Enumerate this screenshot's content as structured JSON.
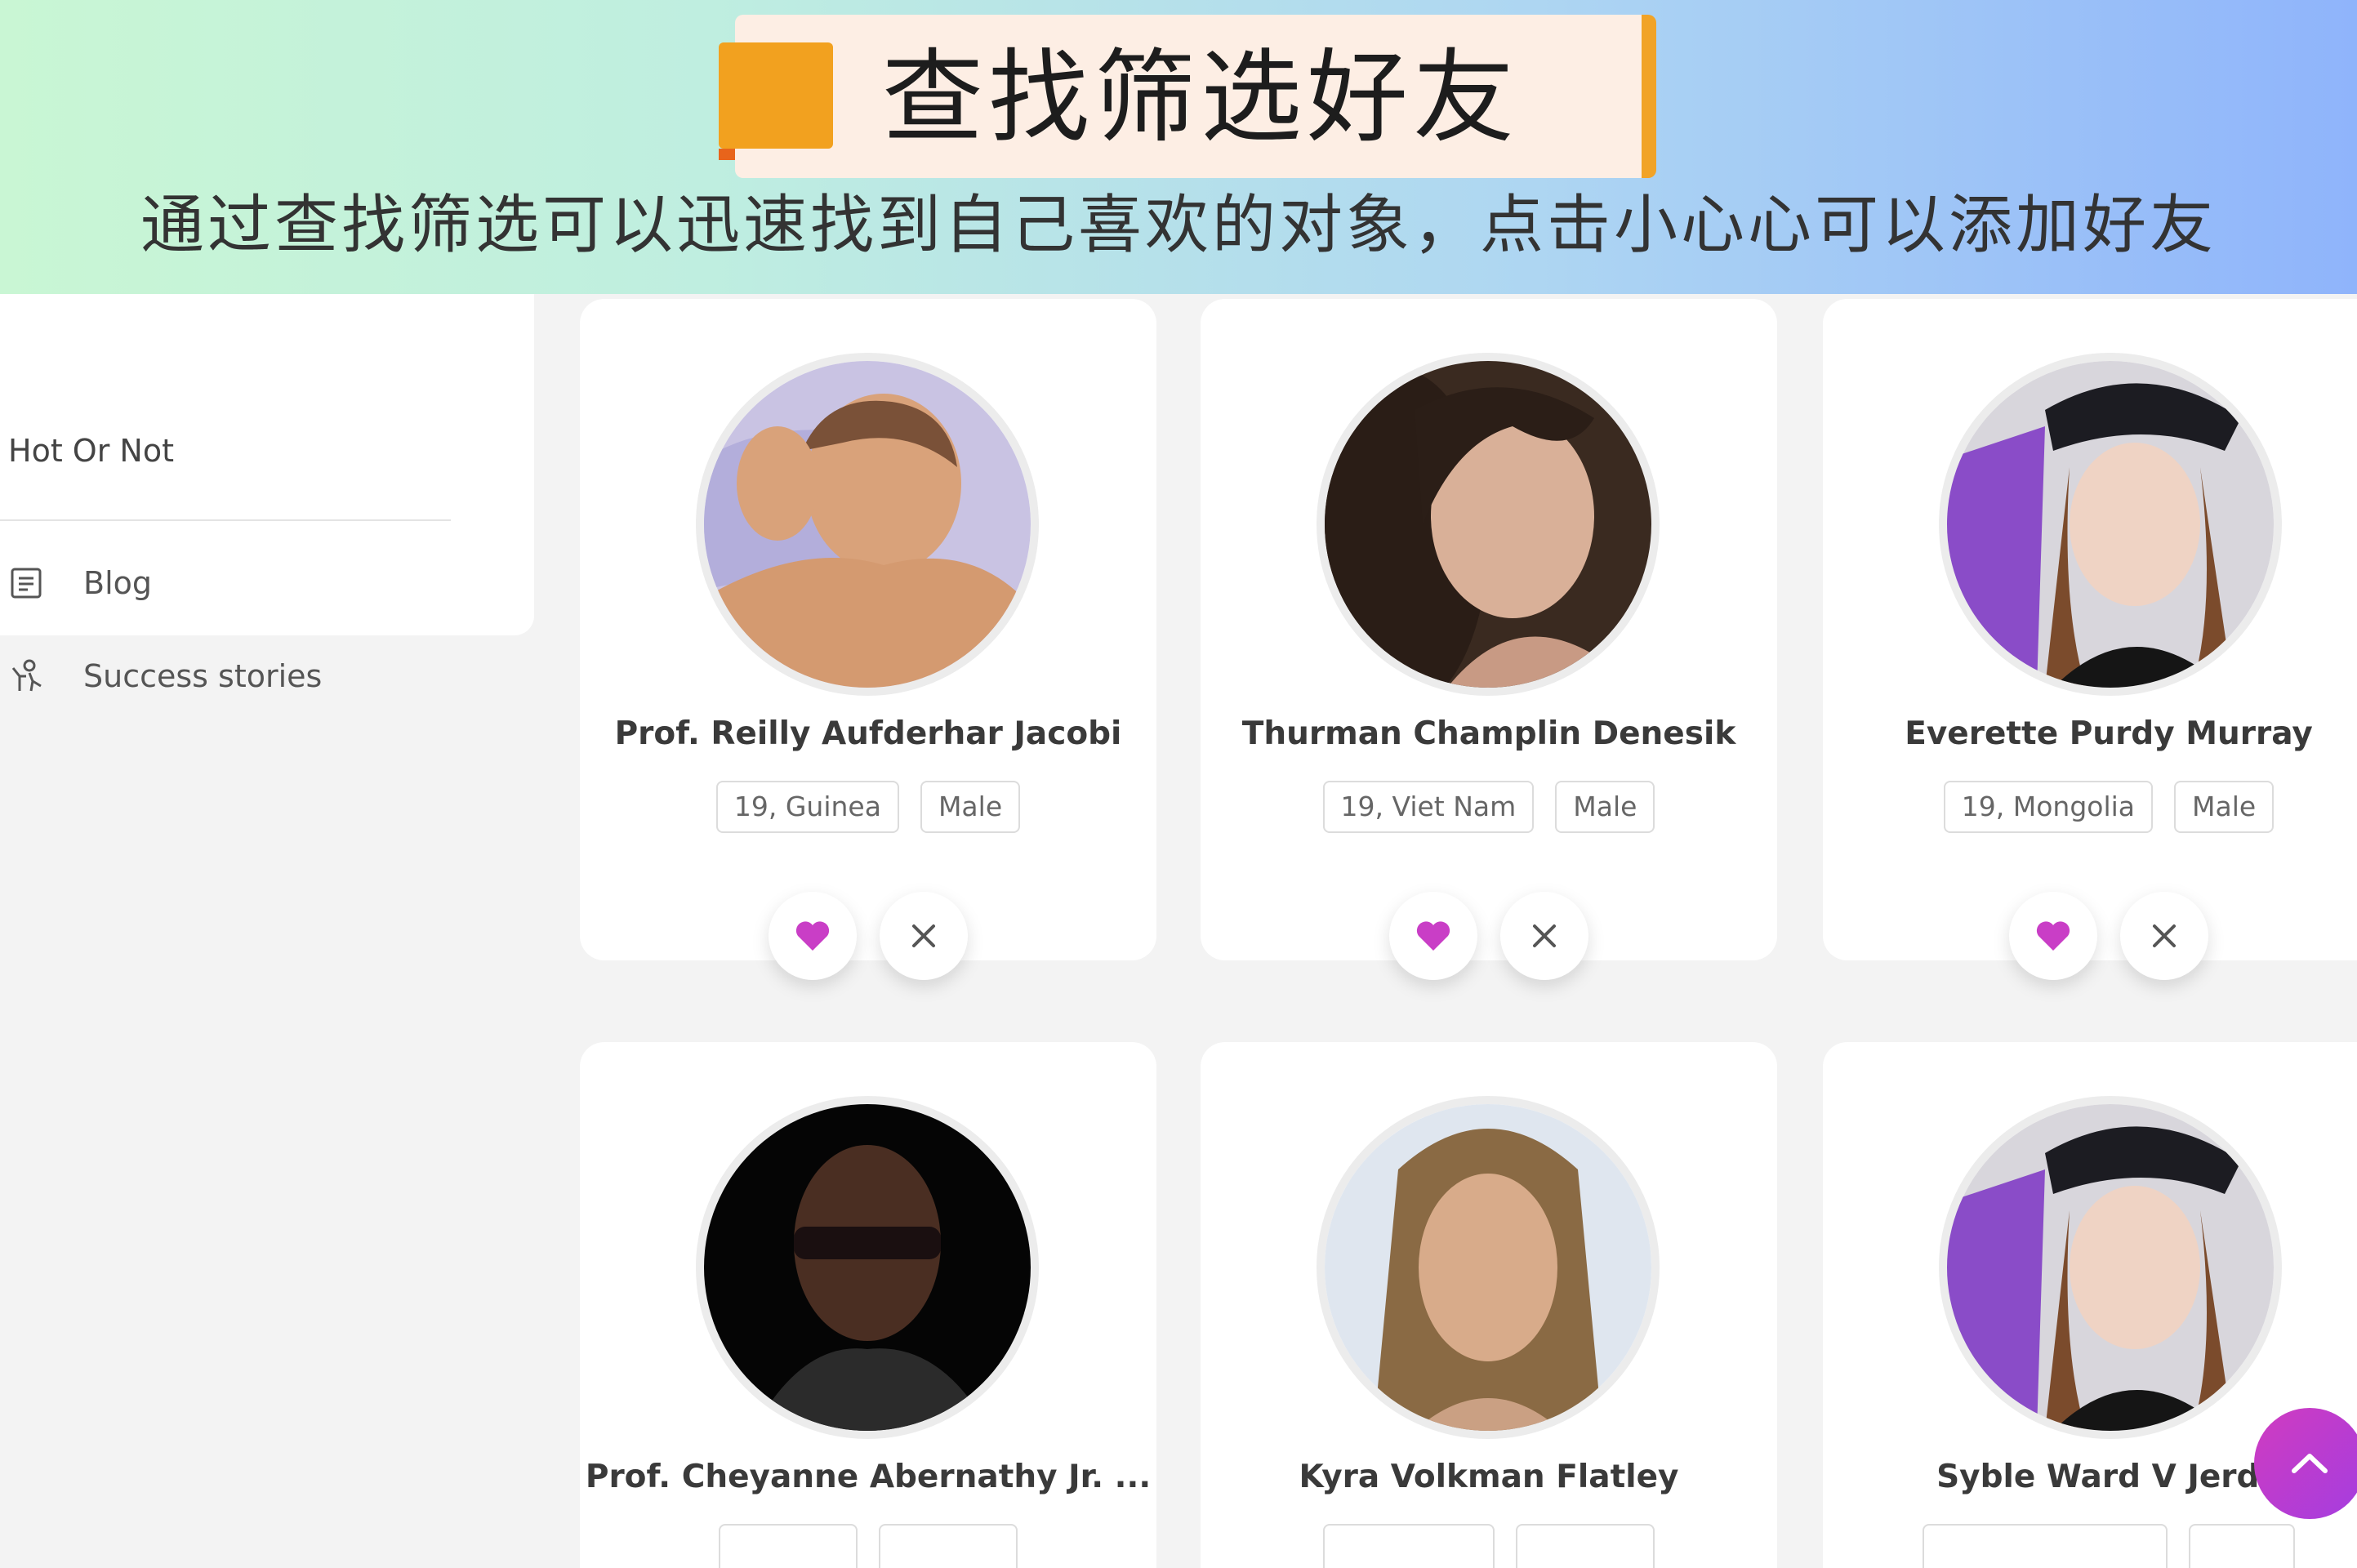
{
  "banner": {
    "title": "查找筛选好友",
    "subtitle": "通过查找筛选可以迅速找到自己喜欢的对象，点击小心心可以添加好友"
  },
  "sidebar": {
    "partial_item": "Hot Or Not",
    "items": [
      {
        "label": "Blog",
        "icon": "document-icon"
      },
      {
        "label": "Success stories",
        "icon": "people-icon"
      }
    ]
  },
  "cards": [
    {
      "name": "Prof. Reilly Aufderhar Jacobi",
      "age_country": "19, Guinea",
      "gender": "Male"
    },
    {
      "name": "Thurman Champlin Denesik",
      "age_country": "19, Viet Nam",
      "gender": "Male"
    },
    {
      "name": "Everette Purdy Murray",
      "age_country": "19, Mongolia",
      "gender": "Male"
    },
    {
      "name": "Prof. Cheyanne Abernathy Jr. ...",
      "age_country": "",
      "gender": ""
    },
    {
      "name": "Kyra Volkman Flatley",
      "age_country": "",
      "gender": ""
    },
    {
      "name": "Syble Ward V Jerde",
      "age_country": "",
      "gender": ""
    }
  ],
  "icons": {
    "like": "heart-icon",
    "dismiss": "close-icon",
    "scroll_top": "chevron-up-icon"
  },
  "colors": {
    "heart": "#c93ec6",
    "accent_orange": "#f2a11f",
    "scroll_top": "#c23ccb"
  }
}
